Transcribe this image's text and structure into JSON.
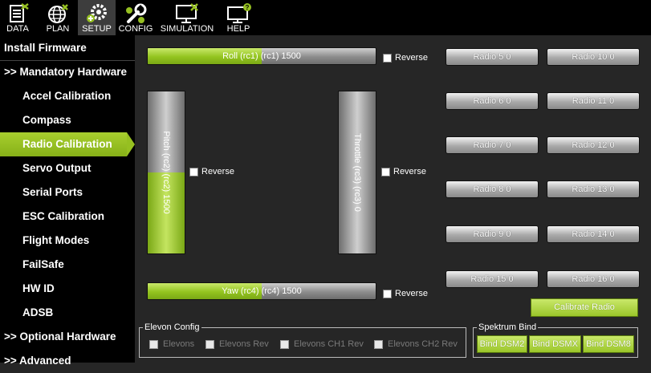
{
  "toolbar": {
    "items": [
      {
        "label": "DATA",
        "icon": "data-icon"
      },
      {
        "label": "PLAN",
        "icon": "globe-icon"
      },
      {
        "label": "SETUP",
        "icon": "gears-icon"
      },
      {
        "label": "CONFIG",
        "icon": "wrench-icon"
      },
      {
        "label": "SIMULATION",
        "icon": "monitor-icon"
      },
      {
        "label": "HELP",
        "icon": "help-monitor-icon"
      }
    ],
    "active": "SETUP"
  },
  "sidebar": {
    "items": [
      {
        "label": "Install Firmware",
        "kind": "section"
      },
      {
        "label": ">> Mandatory Hardware",
        "kind": "section"
      },
      {
        "label": "Accel Calibration",
        "kind": "sub"
      },
      {
        "label": "Compass",
        "kind": "sub"
      },
      {
        "label": "Radio Calibration",
        "kind": "sub",
        "active": true
      },
      {
        "label": "Servo Output",
        "kind": "sub"
      },
      {
        "label": "Serial Ports",
        "kind": "sub"
      },
      {
        "label": "ESC Calibration",
        "kind": "sub"
      },
      {
        "label": "Flight Modes",
        "kind": "sub"
      },
      {
        "label": "FailSafe",
        "kind": "sub"
      },
      {
        "label": "HW ID",
        "kind": "sub"
      },
      {
        "label": "ADSB",
        "kind": "sub"
      },
      {
        "label": ">> Optional Hardware",
        "kind": "section"
      },
      {
        "label": ">> Advanced",
        "kind": "section"
      }
    ]
  },
  "radio": {
    "roll": {
      "label": "Roll (rc1) (rc1)  1500",
      "fill": 0.5
    },
    "pitch": {
      "label": "Pitch (rc2) (rc2)  1500",
      "fill": 0.5
    },
    "throttle": {
      "label": "Throttle (rc3) (rc3)  0",
      "fill": 0.0
    },
    "yaw": {
      "label": "Yaw (rc4) (rc4)  1500",
      "fill": 0.5
    },
    "reverse_label": "Reverse",
    "channels": [
      "Radio 5  0",
      "Radio 10  0",
      "Radio 6  0",
      "Radio 11  0",
      "Radio 7  0",
      "Radio 12  0",
      "Radio 8  0",
      "Radio 13  0",
      "Radio 9  0",
      "Radio 14  0",
      "Radio 15  0",
      "Radio 16  0"
    ],
    "calibrate_label": "Calibrate Radio"
  },
  "elevon": {
    "title": "Elevon Config",
    "options": [
      "Elevons",
      "Elevons Rev",
      "Elevons CH1 Rev",
      "Elevons CH2 Rev"
    ]
  },
  "spektrum": {
    "title": "Spektrum Bind",
    "buttons": [
      "Bind DSM2",
      "Bind DSMX",
      "Bind DSM8"
    ]
  },
  "colors": {
    "accent_green": "#96c021",
    "background": "#262626",
    "sidebar": "#000000"
  }
}
